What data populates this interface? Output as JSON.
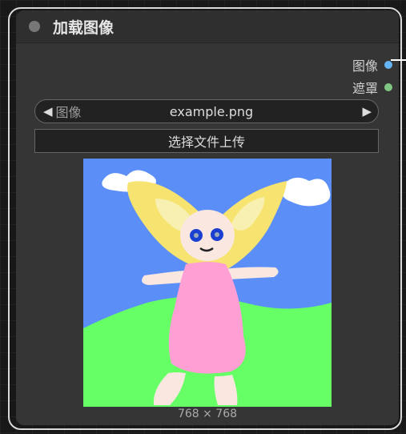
{
  "node": {
    "title": "加载图像",
    "outputs": [
      {
        "label": "图像",
        "color": "#64b5f6"
      },
      {
        "label": "遮罩",
        "color": "#81c784"
      }
    ],
    "image_widget": {
      "label": "图像",
      "value": "example.png"
    },
    "upload_button_label": "选择文件上传",
    "preview": {
      "description_icon": "image-preview",
      "size_label": "768 × 768"
    }
  }
}
